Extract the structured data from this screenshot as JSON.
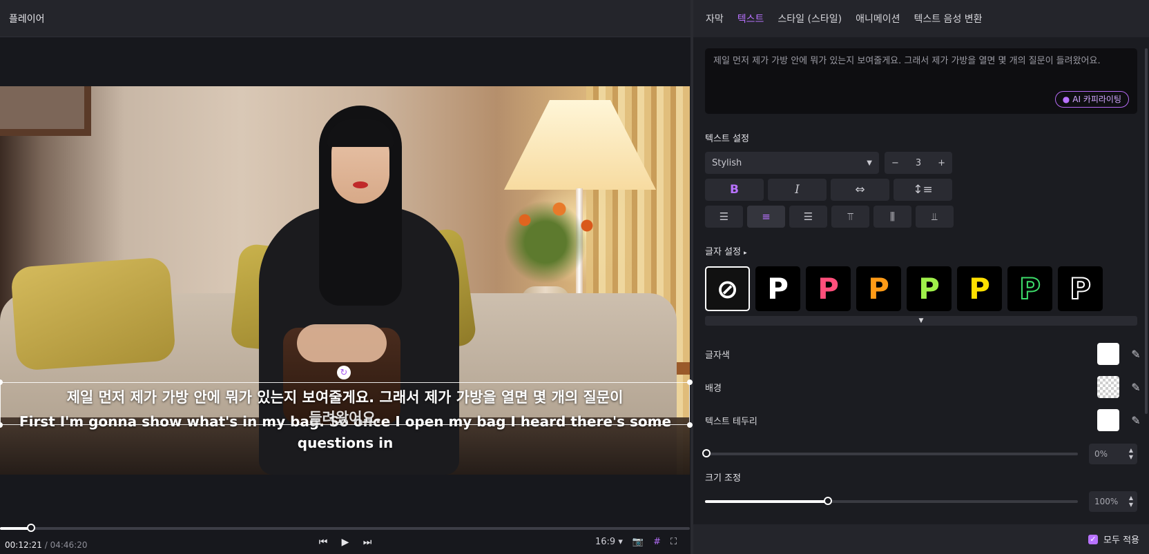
{
  "player": {
    "title": "플레이어",
    "subtitle_ko": "제일 먼저 제가 가방 안에 뭐가 있는지 보여줄게요. 그래서 제가 가방을 열면 몇 개의 질문이",
    "subtitle_ko_overlap": "들려왔어요.",
    "subtitle_en": "First I'm gonna show what's in my bag. So once I open my bag I heard there's some questions in",
    "time_current": "00:12:21",
    "time_separator": "/",
    "time_total": "04:46:20",
    "progress_percent": 4.5,
    "aspect_ratio": "16:9",
    "icons": {
      "prev": "⏮",
      "play": "▶",
      "next": "⏭",
      "camera": "📷",
      "grid": "#",
      "fullscreen": "⛶",
      "rotate": "↻"
    }
  },
  "panel": {
    "tabs": [
      {
        "label": "자막",
        "active": false
      },
      {
        "label": "텍스트",
        "active": true
      },
      {
        "label": "스타일 (스타일)",
        "active": false
      },
      {
        "label": "애니메이션",
        "active": false
      },
      {
        "label": "텍스트 음성 변환",
        "active": false
      }
    ],
    "text_content": "제일 먼저 제가 가방 안에 뭐가 있는지 보여줄게요. 그래서 제가 가방을 열면 몇 개의 질문이 들려왔어요.",
    "ai_button": "AI 카피라이팅",
    "text_settings_label": "텍스트 설정",
    "font_name": "Stylish",
    "font_size": "3",
    "char_settings_label": "글자 설정",
    "presets": [
      {
        "glyph": "⊘",
        "color": "#ffffff",
        "type": "none"
      },
      {
        "glyph": "P",
        "color": "#ffffff",
        "type": "fill"
      },
      {
        "glyph": "P",
        "color": "#ff4f7b",
        "type": "fill"
      },
      {
        "glyph": "P",
        "color": "#ff9a16",
        "type": "fill"
      },
      {
        "glyph": "P",
        "color": "#9ff04a",
        "type": "fill"
      },
      {
        "glyph": "P",
        "color": "#ffe000",
        "type": "fill"
      },
      {
        "glyph": "P",
        "color": "#3ddc6a",
        "type": "outline"
      },
      {
        "glyph": "P",
        "color": "#ffffff",
        "type": "outline"
      }
    ],
    "font_color_label": "글자색",
    "background_label": "배경",
    "border_label": "텍스트 테두리",
    "border_value": "0%",
    "scale_label": "크기 조정",
    "scale_value": "100%",
    "scale_fraction": 0.33,
    "apply_all_label": "모두 적용",
    "accent_color": "#b872ff"
  }
}
